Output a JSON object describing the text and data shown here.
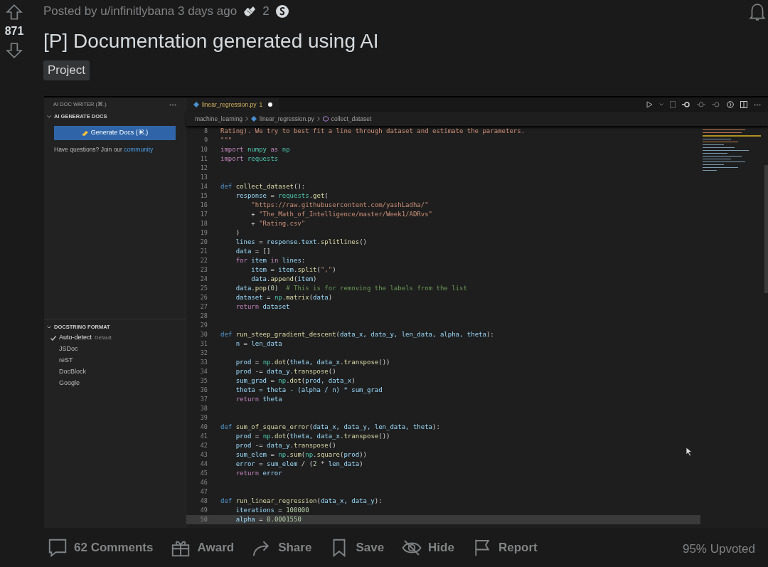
{
  "post": {
    "score": "871",
    "byline": "Posted by u/infinitlybana 3 days ago",
    "award_count": "2",
    "title": "[P] Documentation generated using AI",
    "flair": "Project"
  },
  "sidebar": {
    "header": "AI DOC WRITER (⌘.)",
    "section": "AI GENERATE DOCS",
    "button": "Generate Docs (⌘.)",
    "help_text": "Have questions? Join our",
    "help_link": "community",
    "format_section": "DOCSTRING FORMAT",
    "formats": [
      {
        "label": "Auto-detect",
        "note": "Default",
        "selected": true
      },
      {
        "label": "JSDoc",
        "selected": false
      },
      {
        "label": "reST",
        "selected": false
      },
      {
        "label": "DocBlock",
        "selected": false
      },
      {
        "label": "Google",
        "selected": false
      }
    ]
  },
  "editor": {
    "tab": {
      "label": "linear_regression.py",
      "problems": "1",
      "modified": true
    },
    "breadcrumb": [
      "machine_learning",
      "linear_regression.py",
      "collect_dataset"
    ],
    "lines": [
      {
        "number": "8",
        "highlighted": false,
        "tokens": [
          {
            "kind": "string",
            "text": "Rating). We try to best fit a line through dataset and estimate the parameters."
          }
        ]
      },
      {
        "number": "9",
        "highlighted": false,
        "tokens": [
          {
            "kind": "string",
            "text": "\"\"\""
          }
        ]
      },
      {
        "number": "10",
        "highlighted": false,
        "tokens": [
          {
            "kind": "control",
            "text": "import "
          },
          {
            "kind": "module",
            "text": "numpy"
          },
          {
            "kind": "control",
            "text": " as "
          },
          {
            "kind": "module",
            "text": "np"
          }
        ]
      },
      {
        "number": "11",
        "highlighted": false,
        "tokens": [
          {
            "kind": "control",
            "text": "import "
          },
          {
            "kind": "module",
            "text": "requests"
          }
        ]
      },
      {
        "number": "12",
        "highlighted": false
      },
      {
        "number": "13",
        "highlighted": false
      },
      {
        "number": "14",
        "highlighted": false,
        "tokens": [
          {
            "kind": "keyword",
            "text": "def "
          },
          {
            "kind": "function",
            "text": "collect_dataset"
          },
          {
            "kind": "plain",
            "text": "():"
          }
        ]
      },
      {
        "number": "15",
        "highlighted": false,
        "tokens": [
          {
            "kind": "variable",
            "text": "    response"
          },
          {
            "kind": "plain",
            "text": " = "
          },
          {
            "kind": "module",
            "text": "requests"
          },
          {
            "kind": "plain",
            "text": "."
          },
          {
            "kind": "function",
            "text": "get"
          },
          {
            "kind": "plain",
            "text": "("
          }
        ]
      },
      {
        "number": "16",
        "highlighted": false,
        "tokens": [
          {
            "kind": "string",
            "text": "        \"https://raw.githubusercontent.com/yashLadha/\""
          }
        ]
      },
      {
        "number": "17",
        "highlighted": false,
        "tokens": [
          {
            "kind": "plain",
            "text": "        + "
          },
          {
            "kind": "string",
            "text": "\"The_Math_of_Intelligence/master/Week1/ADRvs\""
          }
        ]
      },
      {
        "number": "18",
        "highlighted": false,
        "tokens": [
          {
            "kind": "plain",
            "text": "        + "
          },
          {
            "kind": "string",
            "text": "\"Rating.csv\""
          }
        ]
      },
      {
        "number": "19",
        "highlighted": false,
        "tokens": [
          {
            "kind": "plain",
            "text": "    )"
          }
        ]
      },
      {
        "number": "20",
        "highlighted": false,
        "tokens": [
          {
            "kind": "variable",
            "text": "    lines"
          },
          {
            "kind": "plain",
            "text": " = "
          },
          {
            "kind": "variable",
            "text": "response"
          },
          {
            "kind": "plain",
            "text": "."
          },
          {
            "kind": "variable",
            "text": "text"
          },
          {
            "kind": "plain",
            "text": "."
          },
          {
            "kind": "function",
            "text": "splitlines"
          },
          {
            "kind": "plain",
            "text": "()"
          }
        ]
      },
      {
        "number": "21",
        "highlighted": false,
        "tokens": [
          {
            "kind": "variable",
            "text": "    data"
          },
          {
            "kind": "plain",
            "text": " = []"
          }
        ]
      },
      {
        "number": "22",
        "highlighted": false,
        "tokens": [
          {
            "kind": "control",
            "text": "    for "
          },
          {
            "kind": "variable",
            "text": "item"
          },
          {
            "kind": "control",
            "text": " in "
          },
          {
            "kind": "variable",
            "text": "lines"
          },
          {
            "kind": "plain",
            "text": ":"
          }
        ]
      },
      {
        "number": "23",
        "highlighted": false,
        "tokens": [
          {
            "kind": "variable",
            "text": "        item"
          },
          {
            "kind": "plain",
            "text": " = "
          },
          {
            "kind": "variable",
            "text": "item"
          },
          {
            "kind": "plain",
            "text": "."
          },
          {
            "kind": "function",
            "text": "split"
          },
          {
            "kind": "plain",
            "text": "("
          },
          {
            "kind": "string",
            "text": "\",\""
          },
          {
            "kind": "plain",
            "text": ")"
          }
        ]
      },
      {
        "number": "24",
        "highlighted": false,
        "tokens": [
          {
            "kind": "variable",
            "text": "        data"
          },
          {
            "kind": "plain",
            "text": "."
          },
          {
            "kind": "function",
            "text": "append"
          },
          {
            "kind": "plain",
            "text": "("
          },
          {
            "kind": "variable",
            "text": "item"
          },
          {
            "kind": "plain",
            "text": ")"
          }
        ]
      },
      {
        "number": "25",
        "highlighted": false,
        "tokens": [
          {
            "kind": "variable",
            "text": "    data"
          },
          {
            "kind": "plain",
            "text": "."
          },
          {
            "kind": "function",
            "text": "pop"
          },
          {
            "kind": "plain",
            "text": "("
          },
          {
            "kind": "number",
            "text": "0"
          },
          {
            "kind": "plain",
            "text": ")  "
          },
          {
            "kind": "comment",
            "text": "# This is for removing the labels from the list"
          }
        ]
      },
      {
        "number": "26",
        "highlighted": false,
        "tokens": [
          {
            "kind": "variable",
            "text": "    dataset"
          },
          {
            "kind": "plain",
            "text": " = "
          },
          {
            "kind": "module",
            "text": "np"
          },
          {
            "kind": "plain",
            "text": "."
          },
          {
            "kind": "function",
            "text": "matrix"
          },
          {
            "kind": "plain",
            "text": "("
          },
          {
            "kind": "variable",
            "text": "data"
          },
          {
            "kind": "plain",
            "text": ")"
          }
        ]
      },
      {
        "number": "27",
        "highlighted": false,
        "tokens": [
          {
            "kind": "control",
            "text": "    return "
          },
          {
            "kind": "variable",
            "text": "dataset"
          }
        ]
      },
      {
        "number": "28",
        "highlighted": false
      },
      {
        "number": "29",
        "highlighted": false
      },
      {
        "number": "30",
        "highlighted": false,
        "tokens": [
          {
            "kind": "keyword",
            "text": "def "
          },
          {
            "kind": "function",
            "text": "run_steep_gradient_descent"
          },
          {
            "kind": "plain",
            "text": "("
          },
          {
            "kind": "variable",
            "text": "data_x, data_y, len_data, alpha, theta"
          },
          {
            "kind": "plain",
            "text": "):"
          }
        ]
      },
      {
        "number": "31",
        "highlighted": false,
        "tokens": [
          {
            "kind": "variable",
            "text": "    n"
          },
          {
            "kind": "plain",
            "text": " = "
          },
          {
            "kind": "variable",
            "text": "len_data"
          }
        ]
      },
      {
        "number": "32",
        "highlighted": false
      },
      {
        "number": "33",
        "highlighted": false,
        "tokens": [
          {
            "kind": "variable",
            "text": "    prod"
          },
          {
            "kind": "plain",
            "text": " = "
          },
          {
            "kind": "module",
            "text": "np"
          },
          {
            "kind": "plain",
            "text": "."
          },
          {
            "kind": "function",
            "text": "dot"
          },
          {
            "kind": "plain",
            "text": "("
          },
          {
            "kind": "variable",
            "text": "theta, data_x"
          },
          {
            "kind": "plain",
            "text": "."
          },
          {
            "kind": "function",
            "text": "transpose"
          },
          {
            "kind": "plain",
            "text": "())"
          }
        ]
      },
      {
        "number": "34",
        "highlighted": false,
        "tokens": [
          {
            "kind": "variable",
            "text": "    prod"
          },
          {
            "kind": "plain",
            "text": " -= "
          },
          {
            "kind": "variable",
            "text": "data_y"
          },
          {
            "kind": "plain",
            "text": "."
          },
          {
            "kind": "function",
            "text": "transpose"
          },
          {
            "kind": "plain",
            "text": "()"
          }
        ]
      },
      {
        "number": "35",
        "highlighted": false,
        "tokens": [
          {
            "kind": "variable",
            "text": "    sum_grad"
          },
          {
            "kind": "plain",
            "text": " = "
          },
          {
            "kind": "module",
            "text": "np"
          },
          {
            "kind": "plain",
            "text": "."
          },
          {
            "kind": "function",
            "text": "dot"
          },
          {
            "kind": "plain",
            "text": "("
          },
          {
            "kind": "variable",
            "text": "prod, data_x"
          },
          {
            "kind": "plain",
            "text": ")"
          }
        ]
      },
      {
        "number": "36",
        "highlighted": false,
        "tokens": [
          {
            "kind": "variable",
            "text": "    theta = theta - (alpha / n) * sum_grad"
          }
        ]
      },
      {
        "number": "37",
        "highlighted": false,
        "tokens": [
          {
            "kind": "control",
            "text": "    return "
          },
          {
            "kind": "variable",
            "text": "theta"
          }
        ]
      },
      {
        "number": "38",
        "highlighted": false
      },
      {
        "number": "39",
        "highlighted": false
      },
      {
        "number": "40",
        "highlighted": false,
        "tokens": [
          {
            "kind": "keyword",
            "text": "def "
          },
          {
            "kind": "function",
            "text": "sum_of_square_error"
          },
          {
            "kind": "plain",
            "text": "("
          },
          {
            "kind": "variable",
            "text": "data_x, data_y, len_data, theta"
          },
          {
            "kind": "plain",
            "text": "):"
          }
        ]
      },
      {
        "number": "41",
        "highlighted": false,
        "tokens": [
          {
            "kind": "variable",
            "text": "    prod"
          },
          {
            "kind": "plain",
            "text": " = "
          },
          {
            "kind": "module",
            "text": "np"
          },
          {
            "kind": "plain",
            "text": "."
          },
          {
            "kind": "function",
            "text": "dot"
          },
          {
            "kind": "plain",
            "text": "("
          },
          {
            "kind": "variable",
            "text": "theta, data_x"
          },
          {
            "kind": "plain",
            "text": "."
          },
          {
            "kind": "function",
            "text": "transpose"
          },
          {
            "kind": "plain",
            "text": "())"
          }
        ]
      },
      {
        "number": "42",
        "highlighted": false,
        "tokens": [
          {
            "kind": "variable",
            "text": "    prod"
          },
          {
            "kind": "plain",
            "text": " -= "
          },
          {
            "kind": "variable",
            "text": "data_y"
          },
          {
            "kind": "plain",
            "text": "."
          },
          {
            "kind": "function",
            "text": "transpose"
          },
          {
            "kind": "plain",
            "text": "()"
          }
        ]
      },
      {
        "number": "43",
        "highlighted": false,
        "tokens": [
          {
            "kind": "variable",
            "text": "    sum_elem"
          },
          {
            "kind": "plain",
            "text": " = "
          },
          {
            "kind": "module",
            "text": "np"
          },
          {
            "kind": "plain",
            "text": "."
          },
          {
            "kind": "function",
            "text": "sum"
          },
          {
            "kind": "plain",
            "text": "("
          },
          {
            "kind": "module",
            "text": "np"
          },
          {
            "kind": "plain",
            "text": "."
          },
          {
            "kind": "function",
            "text": "square"
          },
          {
            "kind": "plain",
            "text": "("
          },
          {
            "kind": "variable",
            "text": "prod"
          },
          {
            "kind": "plain",
            "text": "))"
          }
        ]
      },
      {
        "number": "44",
        "highlighted": false,
        "tokens": [
          {
            "kind": "variable",
            "text": "    error"
          },
          {
            "kind": "plain",
            "text": " = "
          },
          {
            "kind": "variable",
            "text": "sum_elem"
          },
          {
            "kind": "plain",
            "text": " / ("
          },
          {
            "kind": "number",
            "text": "2"
          },
          {
            "kind": "plain",
            "text": " * "
          },
          {
            "kind": "variable",
            "text": "len_data"
          },
          {
            "kind": "plain",
            "text": ")"
          }
        ]
      },
      {
        "number": "45",
        "highlighted": false,
        "tokens": [
          {
            "kind": "control",
            "text": "    return "
          },
          {
            "kind": "variable",
            "text": "error"
          }
        ]
      },
      {
        "number": "46",
        "highlighted": false
      },
      {
        "number": "47",
        "highlighted": false
      },
      {
        "number": "48",
        "highlighted": false,
        "tokens": [
          {
            "kind": "keyword",
            "text": "def "
          },
          {
            "kind": "function",
            "text": "run_linear_regression"
          },
          {
            "kind": "plain",
            "text": "("
          },
          {
            "kind": "variable",
            "text": "data_x, data_y"
          },
          {
            "kind": "plain",
            "text": "):"
          }
        ]
      },
      {
        "number": "49",
        "highlighted": false,
        "tokens": [
          {
            "kind": "variable",
            "text": "    iterations"
          },
          {
            "kind": "plain",
            "text": " = "
          },
          {
            "kind": "number",
            "text": "100000"
          }
        ]
      },
      {
        "number": "50",
        "highlighted": true,
        "tokens": [
          {
            "kind": "variable",
            "text": "    alpha"
          },
          {
            "kind": "plain",
            "text": " = "
          },
          {
            "kind": "number",
            "text": "0.0001550"
          }
        ]
      }
    ]
  },
  "actions": [
    {
      "kind": "comments",
      "label": "62 Comments"
    },
    {
      "kind": "award",
      "label": "Award"
    },
    {
      "kind": "share",
      "label": "Share"
    },
    {
      "kind": "save",
      "label": "Save"
    },
    {
      "kind": "hide",
      "label": "Hide"
    },
    {
      "kind": "report",
      "label": "Report"
    }
  ],
  "upvote_ratio": "95% Upvoted"
}
